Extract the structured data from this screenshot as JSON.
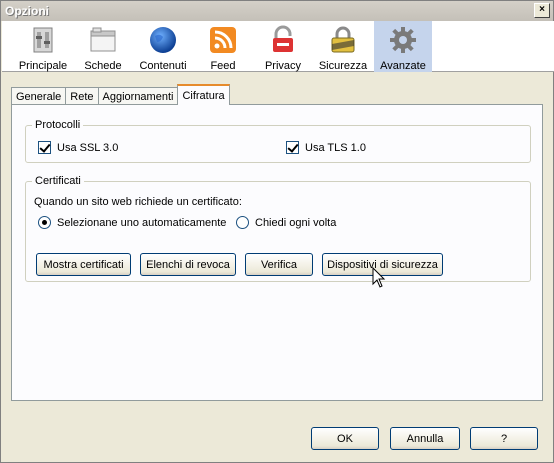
{
  "window": {
    "title": "Opzioni",
    "close_label": "×"
  },
  "toolbar": {
    "panes": [
      {
        "label": "Principale",
        "icon": "general-settings-icon"
      },
      {
        "label": "Schede",
        "icon": "tabs-icon"
      },
      {
        "label": "Contenuti",
        "icon": "globe-icon"
      },
      {
        "label": "Feed",
        "icon": "rss-feed-icon"
      },
      {
        "label": "Privacy",
        "icon": "privacy-lock-icon"
      },
      {
        "label": "Sicurezza",
        "icon": "security-padlock-icon"
      },
      {
        "label": "Avanzate",
        "icon": "gear-icon"
      }
    ],
    "selected": "Avanzate"
  },
  "tabs": [
    "Generale",
    "Rete",
    "Aggiornamenti",
    "Cifratura"
  ],
  "active_tab": "Cifratura",
  "protocols": {
    "legend": "Protocolli",
    "ssl": {
      "label": "Usa SSL 3.0",
      "checked": true
    },
    "tls": {
      "label": "Usa TLS 1.0",
      "checked": true
    }
  },
  "certificates": {
    "legend": "Certificati",
    "question": "Quando un sito web richiede un certificato:",
    "option_auto": {
      "label": "Selezionane uno automaticamente",
      "selected": true
    },
    "option_ask": {
      "label": "Chiedi ogni volta",
      "selected": false
    },
    "buttons": {
      "show": "Mostra certificati",
      "revocation": "Elenchi di revoca",
      "verify": "Verifica",
      "devices": "Dispositivi di sicurezza"
    }
  },
  "footer": {
    "ok": "OK",
    "cancel": "Annulla",
    "help": "?"
  },
  "colors": {
    "accent_tab": "#e68b2c",
    "selected_pane": "#c5d4ec",
    "button_border": "#003c74"
  }
}
